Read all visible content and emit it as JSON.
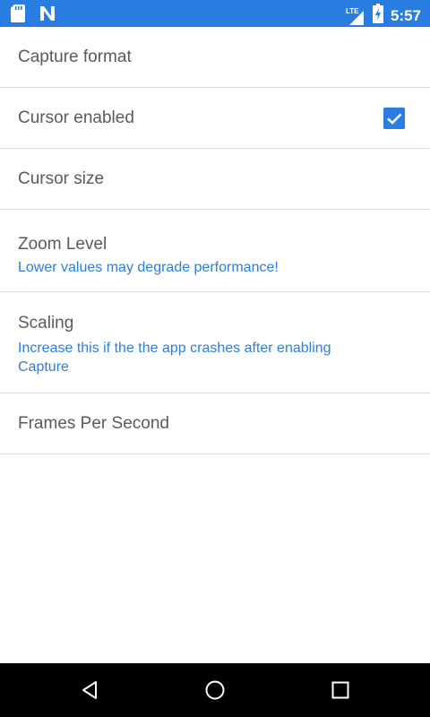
{
  "status_bar": {
    "network_label": "LTE",
    "time": "5:57",
    "icons": [
      "sd-card-icon",
      "notification-n-icon",
      "signal-icon",
      "battery-charging-icon"
    ]
  },
  "preferences": [
    {
      "title": "Capture format"
    },
    {
      "title": "Cursor enabled",
      "checked": true
    },
    {
      "title": "Cursor size"
    },
    {
      "title": "Zoom Level",
      "summary": "Lower values may degrade performance!"
    },
    {
      "title": "Scaling",
      "summary": "Increase this if the the app crashes after enabling Capture"
    },
    {
      "title": "Frames Per Second"
    }
  ],
  "colors": {
    "status_bar": "#2a7de0",
    "accent": "#2b7de1",
    "title_text": "#5a5a5a",
    "divider": "#dcdcdc",
    "nav_bar": "#000000"
  },
  "nav_bar": {
    "icons": [
      "back-icon",
      "home-icon",
      "recents-icon"
    ]
  }
}
